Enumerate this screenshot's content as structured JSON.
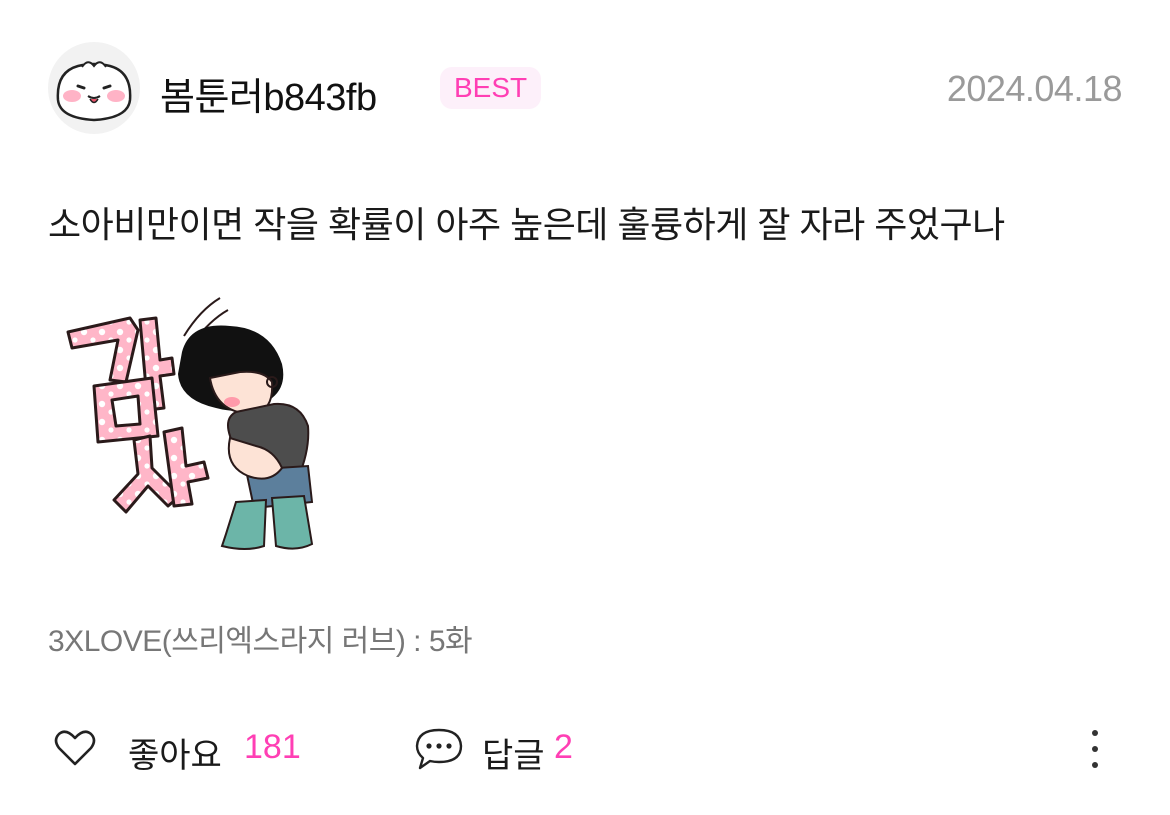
{
  "comment": {
    "username": "봄툰러b843fb",
    "badge": "BEST",
    "date": "2024.04.18",
    "body": "소아비만이면 작을 확률이 아주 높은데 훌륭하게 잘 자라 주었구나",
    "sticker": {
      "text": "감사",
      "icon": "thanks-sticker"
    },
    "source": "3XLOVE(쓰리엑스라지 러브) : 5화"
  },
  "actions": {
    "like_label": "좋아요",
    "like_count": "181",
    "reply_label": "답글",
    "reply_count": "2"
  },
  "colors": {
    "accent": "#ff3fb4",
    "badge_bg": "#fdf0fa",
    "date": "#9a9a9a",
    "muted": "#777777"
  }
}
